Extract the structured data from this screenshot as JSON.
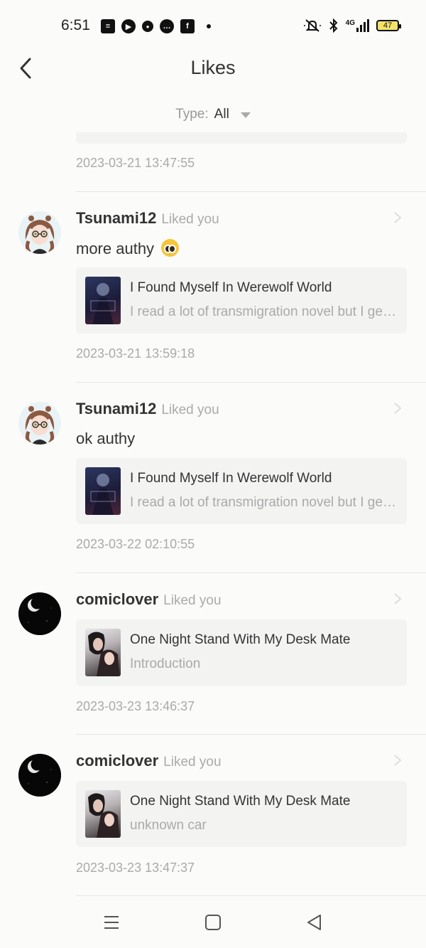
{
  "status_bar": {
    "time": "6:51",
    "battery": "47",
    "network": "4G",
    "left_icons": [
      "news-icon",
      "play-icon",
      "circle-app-icon",
      "chat-icon",
      "facebook-icon"
    ],
    "right_icons": [
      "mute-icon",
      "bluetooth-icon",
      "signal-icon",
      "battery-icon"
    ]
  },
  "header": {
    "title": "Likes",
    "type_label": "Type:",
    "type_value": "All"
  },
  "partial_item": {
    "timestamp": "2023-03-21 13:47:55"
  },
  "items": [
    {
      "username": "Tsunami12",
      "action": "Liked you",
      "avatar": "anime-girl-avatar",
      "comment": "more authy",
      "emoji": "pleading-face",
      "book_title": "I Found Myself In Werewolf World",
      "book_snippet": "I read a lot of transmigration novel but I get bored",
      "timestamp": "2023-03-21 13:59:18"
    },
    {
      "username": "Tsunami12",
      "action": "Liked you",
      "avatar": "anime-girl-avatar",
      "comment": "ok authy",
      "book_title": "I Found Myself In Werewolf World",
      "book_snippet": "I read a lot of transmigration novel but I get bored",
      "timestamp": "2023-03-22 02:10:55"
    },
    {
      "username": "comiclover",
      "action": "Liked you",
      "avatar": "moon-night-avatar",
      "book_title": "One Night Stand With My Desk Mate",
      "book_snippet": "Introduction",
      "timestamp": "2023-03-23 13:46:37"
    },
    {
      "username": "comiclover",
      "action": "Liked you",
      "avatar": "moon-night-avatar",
      "book_title": "One Night Stand With My Desk Mate",
      "book_snippet": "unknown car",
      "timestamp": "2023-03-23 13:47:37"
    }
  ],
  "colors": {
    "background": "#fbfbf9",
    "card": "#f3f3f2",
    "text_primary": "#333333",
    "text_secondary": "#aaaaaa",
    "battery_fill": "#f3e36b"
  }
}
